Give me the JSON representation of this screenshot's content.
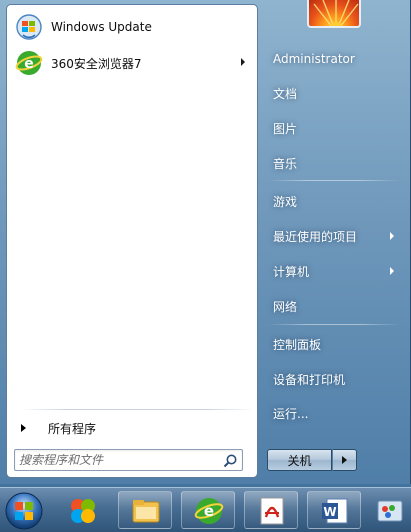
{
  "pinned_programs": [
    {
      "label": "Windows Update",
      "icon": "windows-update-icon",
      "has_arrow": false
    },
    {
      "label": "360安全浏览器7",
      "icon": "360-browser-icon",
      "has_arrow": true
    }
  ],
  "all_programs_label": "所有程序",
  "search": {
    "placeholder": "搜索程序和文件",
    "value": ""
  },
  "right_pane": {
    "user": "Administrator",
    "items": [
      {
        "label": "文档",
        "has_arrow": false
      },
      {
        "label": "图片",
        "has_arrow": false
      },
      {
        "label": "音乐",
        "has_arrow": false
      },
      {
        "label": "游戏",
        "has_arrow": false
      },
      {
        "label": "最近使用的项目",
        "has_arrow": true
      },
      {
        "label": "计算机",
        "has_arrow": true
      },
      {
        "label": "网络",
        "has_arrow": false
      },
      {
        "label": "控制面板",
        "has_arrow": false
      },
      {
        "label": "设备和打印机",
        "has_arrow": false
      },
      {
        "label": "运行...",
        "has_arrow": false
      }
    ]
  },
  "shutdown_label": "关机",
  "taskbar": {
    "icons": [
      "start-orb-icon",
      "media-center-icon",
      "file-explorer-icon",
      "360-browser-icon",
      "pdf-reader-icon",
      "word-icon",
      "paint-icon"
    ]
  },
  "colors": {
    "right_text": "#ffffff",
    "accent_blue": "#1f5fa8",
    "browser_green": "#3aaa2e"
  }
}
